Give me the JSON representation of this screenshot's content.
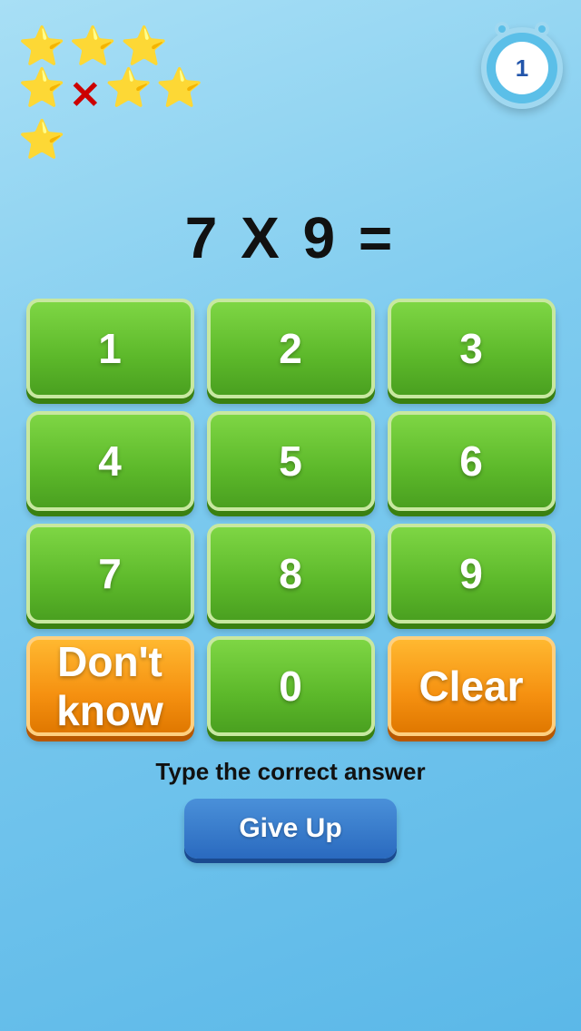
{
  "header": {
    "stars": [
      "⭐",
      "⭐",
      "⭐",
      "⭐",
      "⭐",
      "⭐"
    ],
    "x_count": 1,
    "timer_value": "1"
  },
  "math": {
    "problem": "7 X 9 ="
  },
  "keypad": {
    "rows": [
      [
        "1",
        "2",
        "3"
      ],
      [
        "4",
        "5",
        "6"
      ],
      [
        "7",
        "8",
        "9"
      ]
    ],
    "bottom_row": {
      "left_label": "Don't know",
      "center_label": "0",
      "right_label": "Clear"
    }
  },
  "footer": {
    "instruction": "Type the correct answer",
    "give_up_label": "Give Up"
  }
}
